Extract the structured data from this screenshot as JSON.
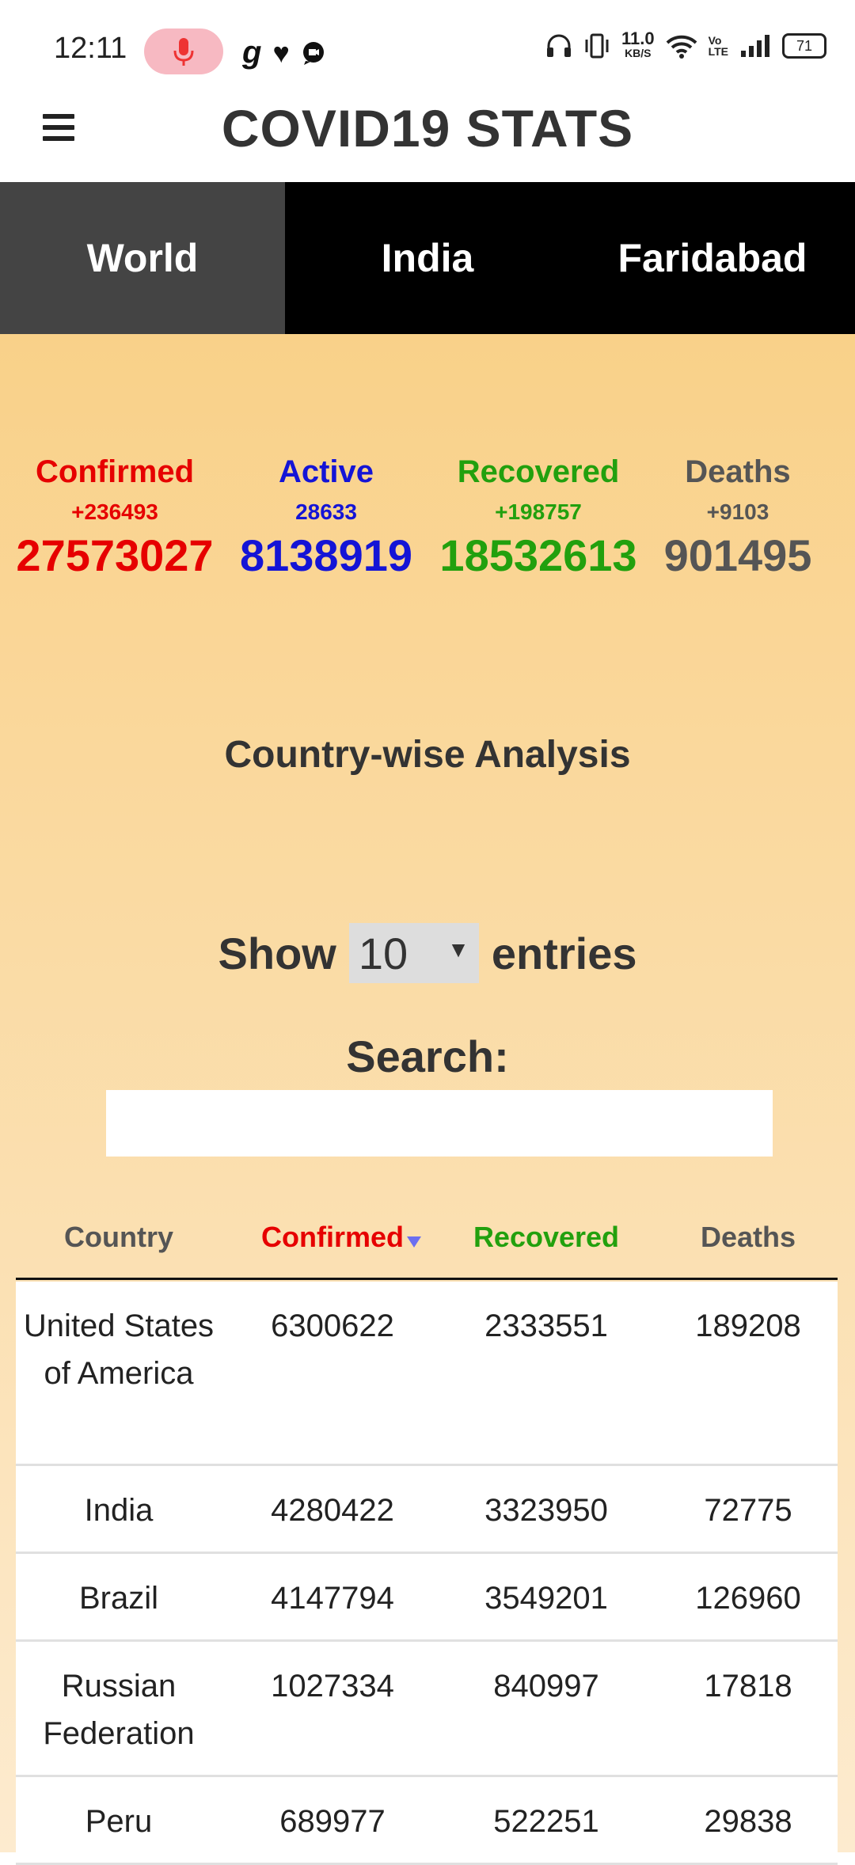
{
  "status_bar": {
    "time": "12:11",
    "net_speed_value": "11.0",
    "net_speed_unit": "KB/S",
    "battery": "71",
    "icons": [
      "mic-icon",
      "g-app-icon",
      "heart-icon",
      "chat-icon",
      "headphones-icon",
      "vibrate-icon",
      "wifi-icon",
      "volte-icon",
      "signal-icon",
      "battery-icon"
    ]
  },
  "header": {
    "title": "COVID19 STATS"
  },
  "tabs": [
    {
      "label": "World",
      "active": true
    },
    {
      "label": "India",
      "active": false
    },
    {
      "label": "Faridabad",
      "active": false
    }
  ],
  "stats": {
    "confirmed": {
      "label": "Confirmed",
      "delta": "+236493",
      "value": "27573027",
      "color": "#e60000"
    },
    "active": {
      "label": "Active",
      "delta": "28633",
      "value": "8138919",
      "color": "#1414d6"
    },
    "recovered": {
      "label": "Recovered",
      "delta": "+198757",
      "value": "18532613",
      "color": "#22a00e"
    },
    "deaths": {
      "label": "Deaths",
      "delta": "+9103",
      "value": "901495",
      "color": "#555555"
    }
  },
  "analysis": {
    "title": "Country-wise Analysis",
    "show_label": "Show",
    "entries_label": "entries",
    "entries_value": "10",
    "search_label": "Search:",
    "search_value": ""
  },
  "table": {
    "headers": [
      "Country",
      "Confirmed",
      "Recovered",
      "Deaths"
    ],
    "rows": [
      [
        "United States of America",
        "6300622",
        "2333551",
        "189208"
      ],
      [
        "India",
        "4280422",
        "3323950",
        "72775"
      ],
      [
        "Brazil",
        "4147794",
        "3549201",
        "126960"
      ],
      [
        "Russian Federation",
        "1027334",
        "840997",
        "17818"
      ],
      [
        "Peru",
        "689977",
        "522251",
        "29838"
      ]
    ]
  }
}
